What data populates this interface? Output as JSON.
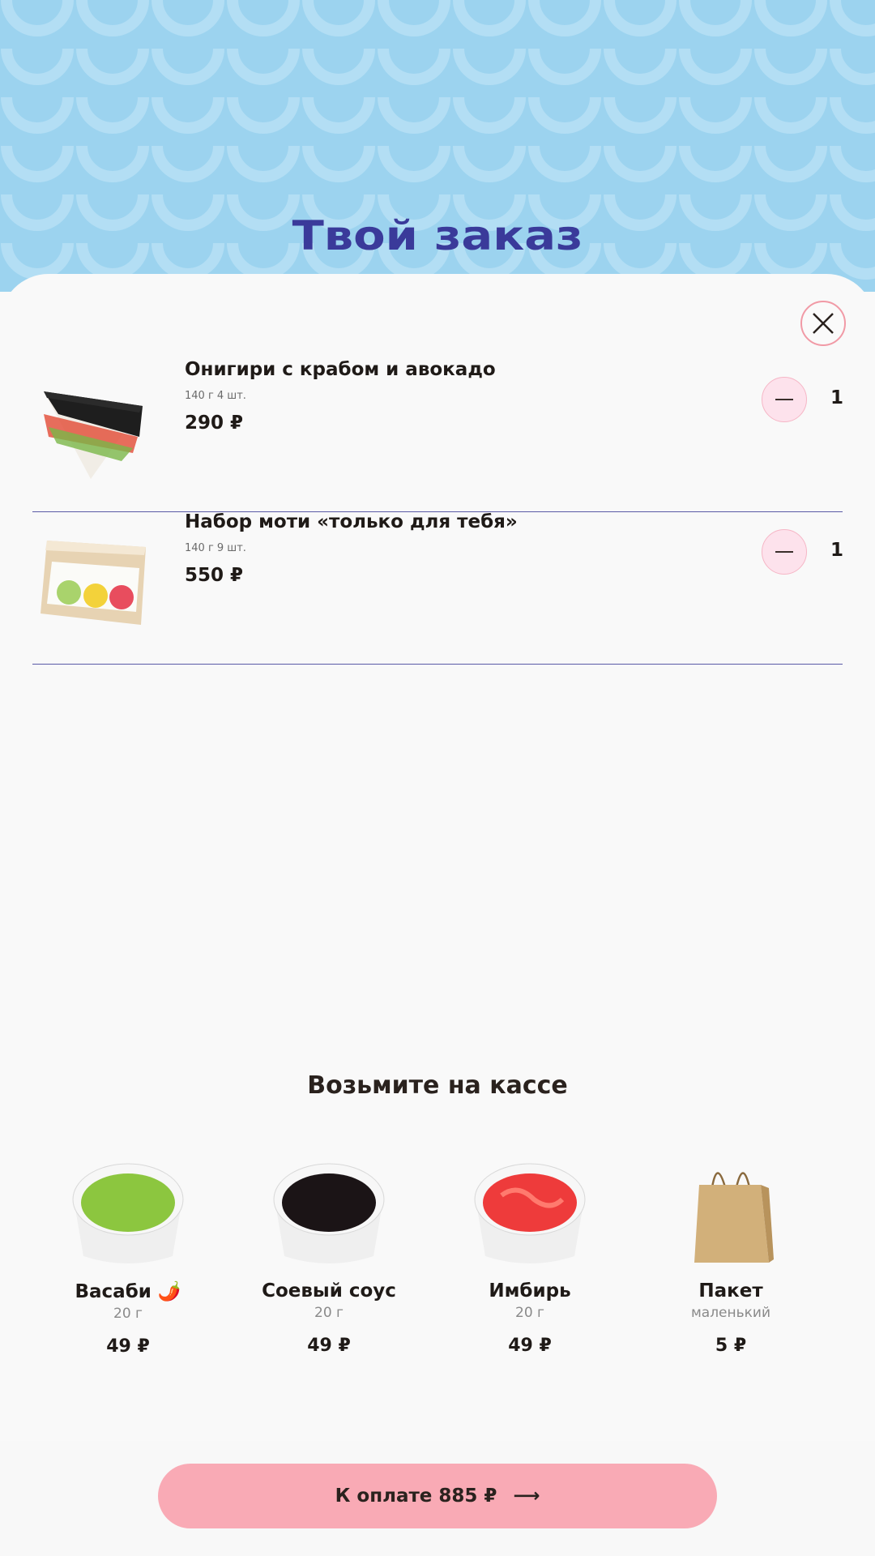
{
  "header": {
    "title": "Твой заказ"
  },
  "order": {
    "items": [
      {
        "name": "Онигири с крабом и авокадо",
        "weight": "140 г 4 шт.",
        "price": "290 ₽",
        "qty": "1"
      },
      {
        "name": "Набор моти «только для тебя»",
        "weight": "140 г 9 шт.",
        "price": "550 ₽",
        "qty": "1"
      }
    ]
  },
  "extras": {
    "title": "Возьмите на кассе",
    "items": [
      {
        "name": "Васаби 🌶️",
        "sub": "20 г",
        "price": "49 ₽"
      },
      {
        "name": "Соевый соус",
        "sub": "20 г",
        "price": "49 ₽"
      },
      {
        "name": "Имбирь",
        "sub": "20 г",
        "price": "49 ₽"
      },
      {
        "name": "Пакет",
        "sub": "маленький",
        "price": "5 ₽"
      }
    ]
  },
  "footer": {
    "pay_label": "К оплате 885 ₽",
    "arrow": "⟶"
  },
  "colors": {
    "header_bg": "#9cd3ef",
    "title": "#3a3a9a",
    "pay_button": "#f9aab5",
    "minus_button": "#fde2ec",
    "divider": "#5a5aa6"
  }
}
